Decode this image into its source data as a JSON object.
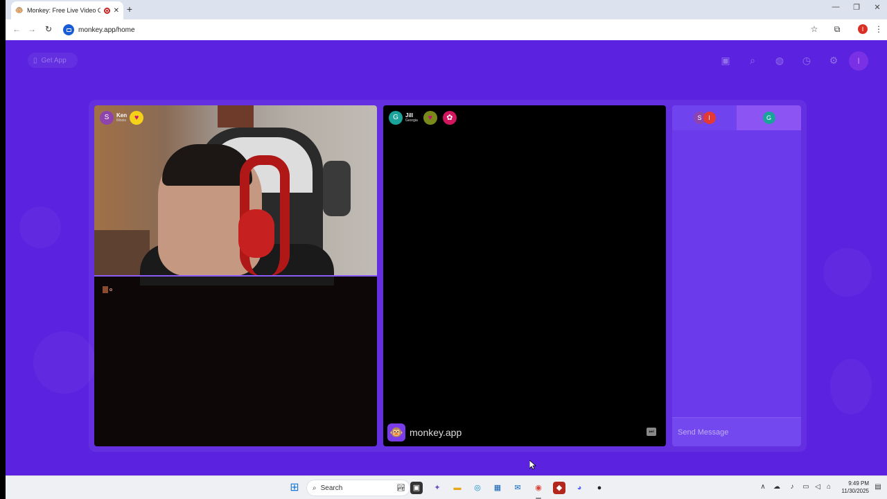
{
  "browser": {
    "tab_title": "Monkey: Free Live Video Ch",
    "new_tab": "+",
    "close_tab": "✕",
    "url": "monkey.app/home",
    "profile_initial": "I",
    "window": {
      "minimize": "—",
      "maximize": "❐",
      "close": "✕"
    }
  },
  "page": {
    "get_app": "Get App",
    "top_avatar_initial": "I"
  },
  "video_left": {
    "user_initial": "S",
    "user_name": "Ken",
    "user_location": "Illinois",
    "avatar_color": "#8e44ad"
  },
  "video_right": {
    "user_initial": "G",
    "user_name": "Jill",
    "user_location": "Georgia",
    "avatar_color": "#1aa39a",
    "brand_text": "monkey.app"
  },
  "chat": {
    "tab1_initials": [
      "S",
      "I"
    ],
    "tab2_initial": "G",
    "message_placeholder": "Send Message"
  },
  "taskbar": {
    "search_label": "Search",
    "time": "9:49 PM",
    "date": "11/30/2025"
  },
  "colors": {
    "page_bg": "#5b22e0",
    "chat_bg": "#6a3aeb",
    "accent_red": "#d93025"
  }
}
